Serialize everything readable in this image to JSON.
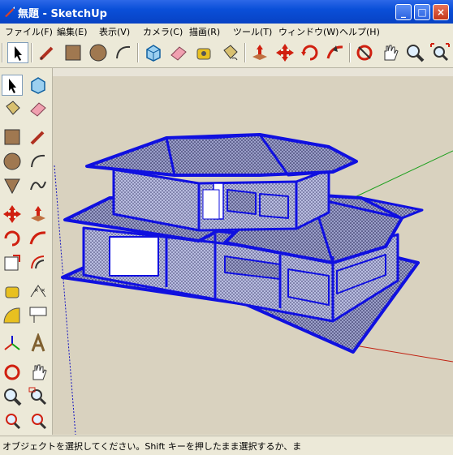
{
  "window": {
    "title": "無題 - SketchUp"
  },
  "window_buttons": {
    "minimize": "_",
    "maximize": "□",
    "close": "×"
  },
  "menu": [
    {
      "label": "ファイル(F)"
    },
    {
      "label": "編集(E)"
    },
    {
      "label": "表示(V)"
    },
    {
      "label": "カメラ(C)"
    },
    {
      "label": "描画(R)"
    },
    {
      "label": "ツール(T)"
    },
    {
      "label": "ウィンドウ(W)"
    },
    {
      "label": "ヘルプ(H)"
    }
  ],
  "top_toolbar": [
    "select-icon",
    "pencil-line-icon",
    "rectangle-icon",
    "circle-icon",
    "arc-icon",
    "make-component-icon",
    "eraser-icon",
    "tape-measure-icon",
    "paint-bucket-icon",
    "push-pull-icon",
    "move-icon",
    "rotate-icon",
    "follow-me-icon",
    "orbit-icon",
    "pan-icon",
    "zoom-icon",
    "zoom-extents-icon"
  ],
  "left_toolbar": [
    "select-icon",
    "make-component-icon",
    "paint-bucket-icon",
    "eraser-icon",
    "rectangle-icon",
    "pencil-line-icon",
    "circle-icon",
    "arc-icon",
    "polygon-icon",
    "freehand-icon",
    "move-icon",
    "push-pull-icon",
    "rotate-icon",
    "follow-me-icon",
    "scale-icon",
    "offset-icon",
    "tape-measure-icon",
    "dimension-icon",
    "protractor-icon",
    "text-icon",
    "axes-icon",
    "3d-text-icon",
    "orbit-icon",
    "pan-icon",
    "zoom-icon",
    "zoom-window-icon",
    "previous-view-icon",
    "next-view-icon"
  ],
  "viewport": {
    "background": "#D9D2BF",
    "sky": "#E8E4D8",
    "model_color": "#1010E0"
  },
  "status": {
    "text": "オブジェクトを選択してください。Shift キーを押したまま選択するか、ま"
  }
}
